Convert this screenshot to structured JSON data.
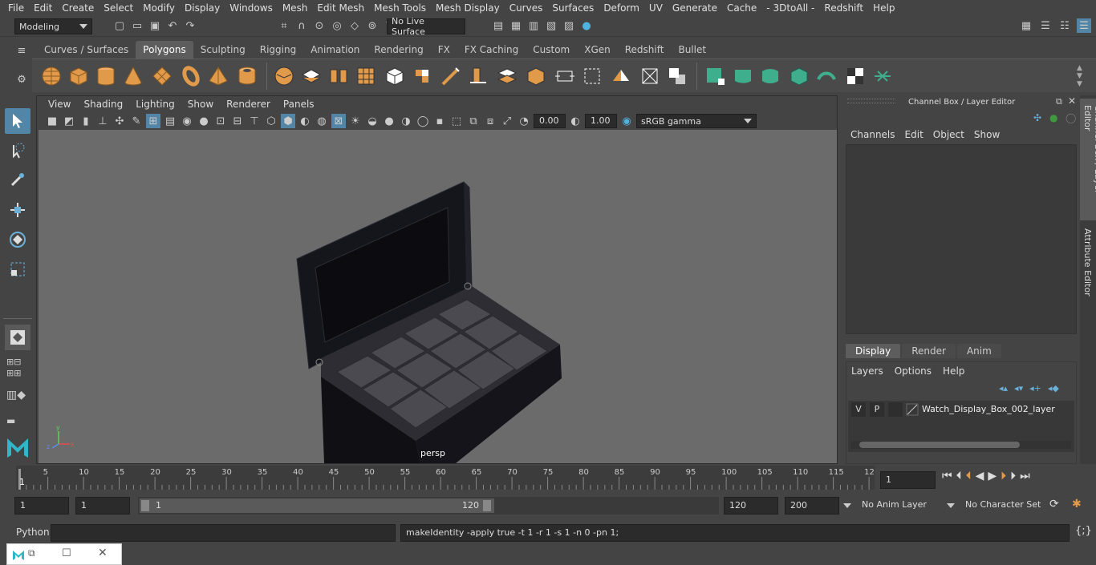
{
  "menubar": [
    "File",
    "Edit",
    "Create",
    "Select",
    "Modify",
    "Display",
    "Windows",
    "Mesh",
    "Edit Mesh",
    "Mesh Tools",
    "Mesh Display",
    "Curves",
    "Surfaces",
    "Deform",
    "UV",
    "Generate",
    "Cache",
    "- 3DtoAll -",
    "Redshift",
    "Help"
  ],
  "status": {
    "workspace": "Modeling",
    "live_surface": "No Live Surface"
  },
  "shelf_tabs": [
    "Curves / Surfaces",
    "Polygons",
    "Sculpting",
    "Rigging",
    "Animation",
    "Rendering",
    "FX",
    "FX Caching",
    "Custom",
    "XGen",
    "Redshift",
    "Bullet"
  ],
  "shelf_active": "Polygons",
  "panel_menu": [
    "View",
    "Shading",
    "Lighting",
    "Show",
    "Renderer",
    "Panels"
  ],
  "panel_toolbar": {
    "exposure": "0.00",
    "gamma": "1.00",
    "color_space": "sRGB gamma"
  },
  "viewport": {
    "camera_label": "persp"
  },
  "channel_box": {
    "title": "Channel Box / Layer Editor",
    "menu": [
      "Channels",
      "Edit",
      "Object",
      "Show"
    ],
    "layer_tabs": [
      "Display",
      "Render",
      "Anim"
    ],
    "layer_active": "Display",
    "layer_menu": [
      "Layers",
      "Options",
      "Help"
    ],
    "layer": {
      "v": "V",
      "p": "P",
      "name": "Watch_Display_Box_002_layer"
    }
  },
  "side_tabs": [
    "Channel Box / Layer Editor",
    "Attribute Editor"
  ],
  "timeline": {
    "ticks": [
      "5",
      "10",
      "15",
      "20",
      "25",
      "30",
      "35",
      "40",
      "45",
      "50",
      "55",
      "60",
      "65",
      "70",
      "75",
      "80",
      "85",
      "90",
      "95",
      "100",
      "105",
      "110",
      "115",
      "12"
    ],
    "current_frame_marker": "1",
    "current_frame": "1"
  },
  "range": {
    "start": "1",
    "anim_start": "1",
    "slider_start": "1",
    "slider_end": "120",
    "end": "120",
    "anim_end": "200",
    "anim_layer": "No Anim Layer",
    "character_set": "No Character Set"
  },
  "command": {
    "language": "Python",
    "output": "makeIdentity -apply true -t 1 -r 1 -s 1 -n 0 -pn 1;"
  },
  "colors": {
    "accent_blue": "#5285a6",
    "shelf_orange": "#e09a4a",
    "shelf_green": "#3fae8c",
    "viewport_bg": "#6b6b6b"
  }
}
